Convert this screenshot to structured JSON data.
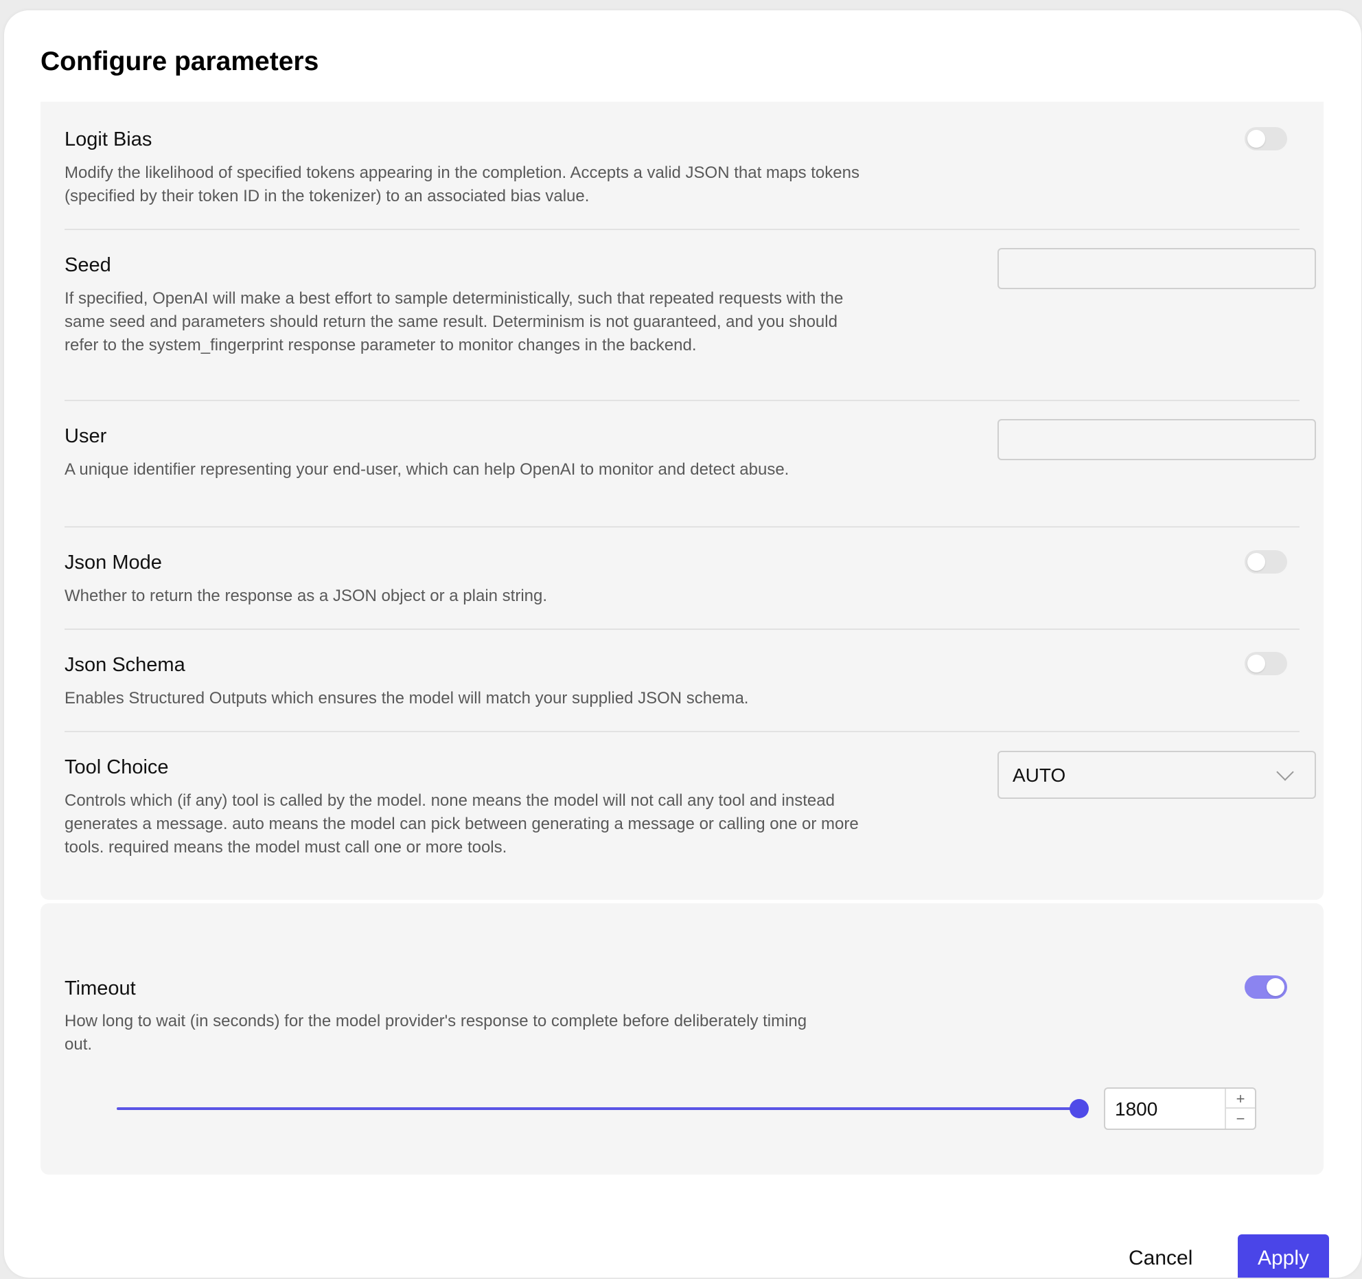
{
  "modal": {
    "title": "Configure parameters"
  },
  "params": {
    "logit_bias": {
      "title": "Logit Bias",
      "description": "Modify the likelihood of specified tokens appearing in the completion. Accepts a valid JSON that maps tokens (specified by their token ID in the tokenizer) to an associated bias value.",
      "enabled": false
    },
    "seed": {
      "title": "Seed",
      "description": "If specified, OpenAI will make a best effort to sample deterministically, such that repeated requests with the same seed and parameters should return the same result. Determinism is not guaranteed, and you should refer to the system_fingerprint response parameter to monitor changes in the backend.",
      "value": ""
    },
    "user": {
      "title": "User",
      "description": "A unique identifier representing your end-user, which can help OpenAI to monitor and detect abuse.",
      "value": ""
    },
    "json_mode": {
      "title": "Json Mode",
      "description": "Whether to return the response as a JSON object or a plain string.",
      "enabled": false
    },
    "json_schema": {
      "title": "Json Schema",
      "description": "Enables Structured Outputs which ensures the model will match your supplied JSON schema.",
      "enabled": false
    },
    "tool_choice": {
      "title": "Tool Choice",
      "description": "Controls which (if any) tool is called by the model. none means the model will not call any tool and instead generates a message. auto means the model can pick between generating a message or calling one or more tools. required means the model must call one or more tools.",
      "selected": "AUTO"
    },
    "timeout": {
      "title": "Timeout",
      "description": "How long to wait (in seconds) for the model provider's response to complete before deliberately timing out.",
      "enabled": true,
      "value": "1800",
      "slider_fraction": 1.0,
      "plus_label": "+",
      "minus_label": "−"
    }
  },
  "footer": {
    "cancel_label": "Cancel",
    "apply_label": "Apply"
  },
  "colors": {
    "accent": "#4a45e8",
    "toggle_on": "#8b84f0",
    "toggle_off": "#e4e4e4",
    "panel_bg": "#f5f5f5"
  },
  "icons": {
    "tool_choice_dropdown": "chevron-down-icon"
  }
}
